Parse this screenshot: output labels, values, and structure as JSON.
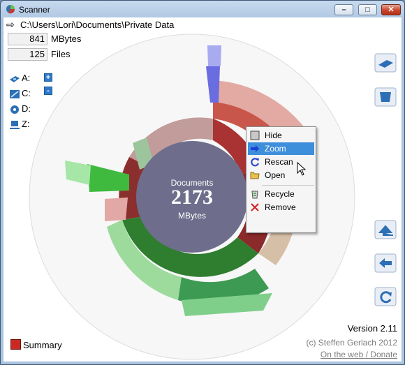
{
  "window": {
    "title": "Scanner"
  },
  "path": "C:\\Users\\Lori\\Documents\\Private Data",
  "stats": [
    {
      "value": "841",
      "label": "MBytes"
    },
    {
      "value": "125",
      "label": "Files"
    }
  ],
  "drives": [
    {
      "label": "A:",
      "icon": "floppy-icon"
    },
    {
      "label": "C:",
      "icon": "harddisk-icon"
    },
    {
      "label": "D:",
      "icon": "cdrom-icon"
    },
    {
      "label": "Z:",
      "icon": "network-drive-icon"
    }
  ],
  "tree_controls": {
    "expand": "+",
    "collapse": "-"
  },
  "center": {
    "name": "Documents",
    "size": "2173",
    "unit": "MBytes"
  },
  "context_menu": {
    "items": [
      {
        "label": "Hide",
        "icon": "hide-icon"
      },
      {
        "label": "Zoom",
        "icon": "zoom-arrow-icon",
        "selected": true
      },
      {
        "label": "Rescan",
        "icon": "rescan-icon"
      },
      {
        "label": "Open",
        "icon": "open-folder-icon"
      },
      {
        "label": "Recycle",
        "icon": "recycle-icon"
      },
      {
        "label": "Remove",
        "icon": "remove-x-icon"
      }
    ]
  },
  "right_toolbar": [
    "scan-drive-icon",
    "scan-folder-icon",
    "parent-up-icon",
    "back-icon",
    "refresh-icon"
  ],
  "footer": {
    "version": "Version 2.11",
    "copyright": "(c) Steffen Gerlach 2012",
    "link": "On the web / Donate",
    "summary": "Summary"
  },
  "colors": {
    "center": "#6e6e8c",
    "green_dark": "#2f7d2f",
    "green_mid": "#4caa4c",
    "red_dark": "#7a1e22",
    "red_mid": "#c93b3b",
    "menu_highlight": "#3d8edb"
  }
}
